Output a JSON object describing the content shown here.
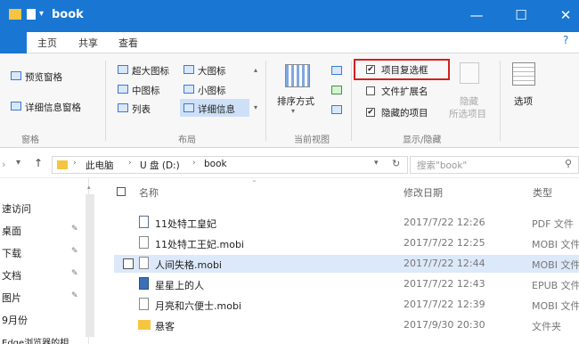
{
  "window": {
    "title": "book"
  },
  "tabs": [
    "主页",
    "共享",
    "查看"
  ],
  "ribbon": {
    "panes": {
      "preview": "预览窗格",
      "details": "详细信息窗格",
      "group_label": "窗格"
    },
    "layout": {
      "items": [
        "超大图标",
        "大图标",
        "中图标",
        "小图标",
        "列表",
        "详细信息"
      ],
      "group_label": "布局"
    },
    "current_view": {
      "sort": "排序方式",
      "group_label": "当前视图"
    },
    "show_hide": {
      "item_checkboxes": {
        "label": "项目复选框",
        "checked": true
      },
      "file_extensions": {
        "label": "文件扩展名",
        "checked": false
      },
      "hidden_items": {
        "label": "隐藏的项目",
        "checked": true
      },
      "hide_selected_1": "隐藏",
      "hide_selected_2": "所选项目",
      "group_label": "显示/隐藏"
    },
    "options": "选项"
  },
  "address": {
    "crumbs": [
      "此电脑",
      "U 盘 (D:)",
      "book"
    ],
    "search_placeholder": "搜索\"book\""
  },
  "nav": [
    {
      "label": "速访问",
      "pinned": false
    },
    {
      "label": "桌面",
      "pinned": true
    },
    {
      "label": "下载",
      "pinned": true
    },
    {
      "label": "文档",
      "pinned": true
    },
    {
      "label": "图片",
      "pinned": true
    },
    {
      "label": "9月份",
      "pinned": false
    },
    {
      "label": "Edge浏览器的相",
      "pinned": false
    }
  ],
  "columns": {
    "name": "名称",
    "date": "修改日期",
    "type": "类型"
  },
  "files": [
    {
      "name": "11处特工皇妃",
      "date": "2017/7/22 12:26",
      "type": "PDF 文件"
    },
    {
      "name": "11处特工王妃.mobi",
      "date": "2017/7/22 12:25",
      "type": "MOBI 文件"
    },
    {
      "name": "人间失格.mobi",
      "date": "2017/7/22 12:44",
      "type": "MOBI 文件"
    },
    {
      "name": "星星上的人",
      "date": "2017/7/22 12:43",
      "type": "EPUB 文件"
    },
    {
      "name": "月亮和六便士.mobi",
      "date": "2017/7/22 12:39",
      "type": "MOBI 文件"
    },
    {
      "name": "悬客",
      "date": "2017/9/30 20:30",
      "type": "文件夹"
    }
  ]
}
